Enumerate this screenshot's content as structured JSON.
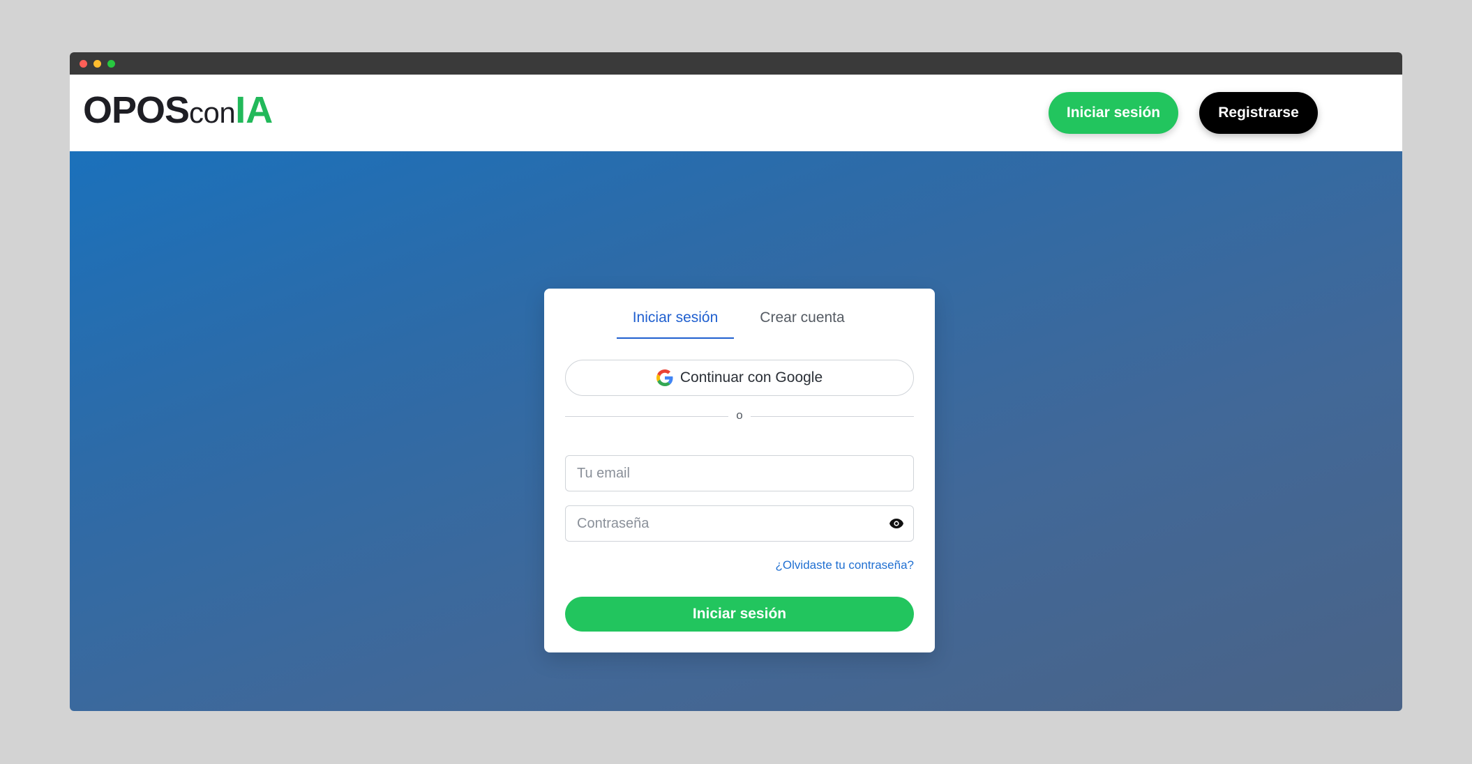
{
  "colors": {
    "accent_green": "#22c55e",
    "tab_active": "#1f5fcf",
    "link": "#1f6fd1",
    "hero_gradient_start": "#1b71bb",
    "hero_gradient_end": "#4a6387"
  },
  "logo": {
    "part1": "OPOS",
    "part2": "con",
    "part3": "IA"
  },
  "nav": {
    "login_label": "Iniciar sesión",
    "register_label": "Registrarse"
  },
  "auth": {
    "tabs": [
      {
        "label": "Iniciar sesión",
        "active": true
      },
      {
        "label": "Crear cuenta",
        "active": false
      }
    ],
    "google_label": "Continuar con Google",
    "google_icon": "google-icon",
    "divider_text": "o",
    "email_placeholder": "Tu email",
    "password_placeholder": "Contraseña",
    "password_icon": "eye-icon",
    "forgot_label": "¿Olvidaste tu contraseña?",
    "submit_label": "Iniciar sesión"
  }
}
